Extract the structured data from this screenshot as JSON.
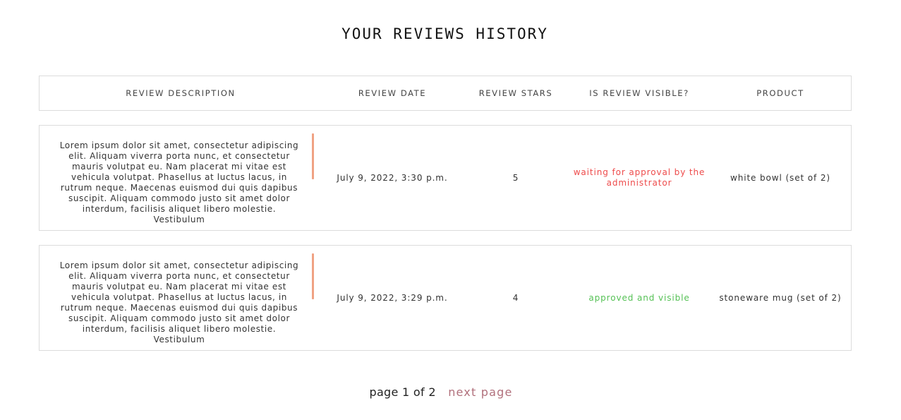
{
  "page": {
    "title": "YOUR REVIEWS HISTORY"
  },
  "table": {
    "headers": {
      "description": "REVIEW DESCRIPTION",
      "date": "REVIEW DATE",
      "stars": "REVIEW STARS",
      "visible": "IS REVIEW VISIBLE?",
      "product": "PRODUCT"
    },
    "rows": [
      {
        "description": "Lorem ipsum dolor sit amet, consectetur adipiscing elit. Aliquam viverra porta nunc, et consectetur mauris volutpat eu. Nam placerat mi vitae est vehicula volutpat. Phasellus at luctus lacus, in rutrum neque. Maecenas euismod dui quis dapibus suscipit. Aliquam commodo justo sit amet dolor interdum, facilisis aliquet libero molestie. Vestibulum",
        "date": "July 9, 2022, 3:30 p.m.",
        "stars": "5",
        "visibility": "waiting for approval by the administrator",
        "visibility_color": "#ee4b4b",
        "product": "white bowl (set of 2)"
      },
      {
        "description": "Lorem ipsum dolor sit amet, consectetur adipiscing elit. Aliquam viverra porta nunc, et consectetur mauris volutpat eu. Nam placerat mi vitae est vehicula volutpat. Phasellus at luctus lacus, in rutrum neque. Maecenas euismod dui quis dapibus suscipit. Aliquam commodo justo sit amet dolor interdum, facilisis aliquet libero molestie. Vestibulum",
        "date": "July 9, 2022, 3:29 p.m.",
        "stars": "4",
        "visibility": "approved and visible",
        "visibility_color": "#55c155",
        "product": "stoneware mug (set of 2)"
      }
    ]
  },
  "pagination": {
    "page_info": "page 1 of 2",
    "next_label": "next page"
  },
  "colors": {
    "scroll_thumb": "#f0a283",
    "next_link": "#b1707c",
    "border": "#dcdcdc"
  }
}
